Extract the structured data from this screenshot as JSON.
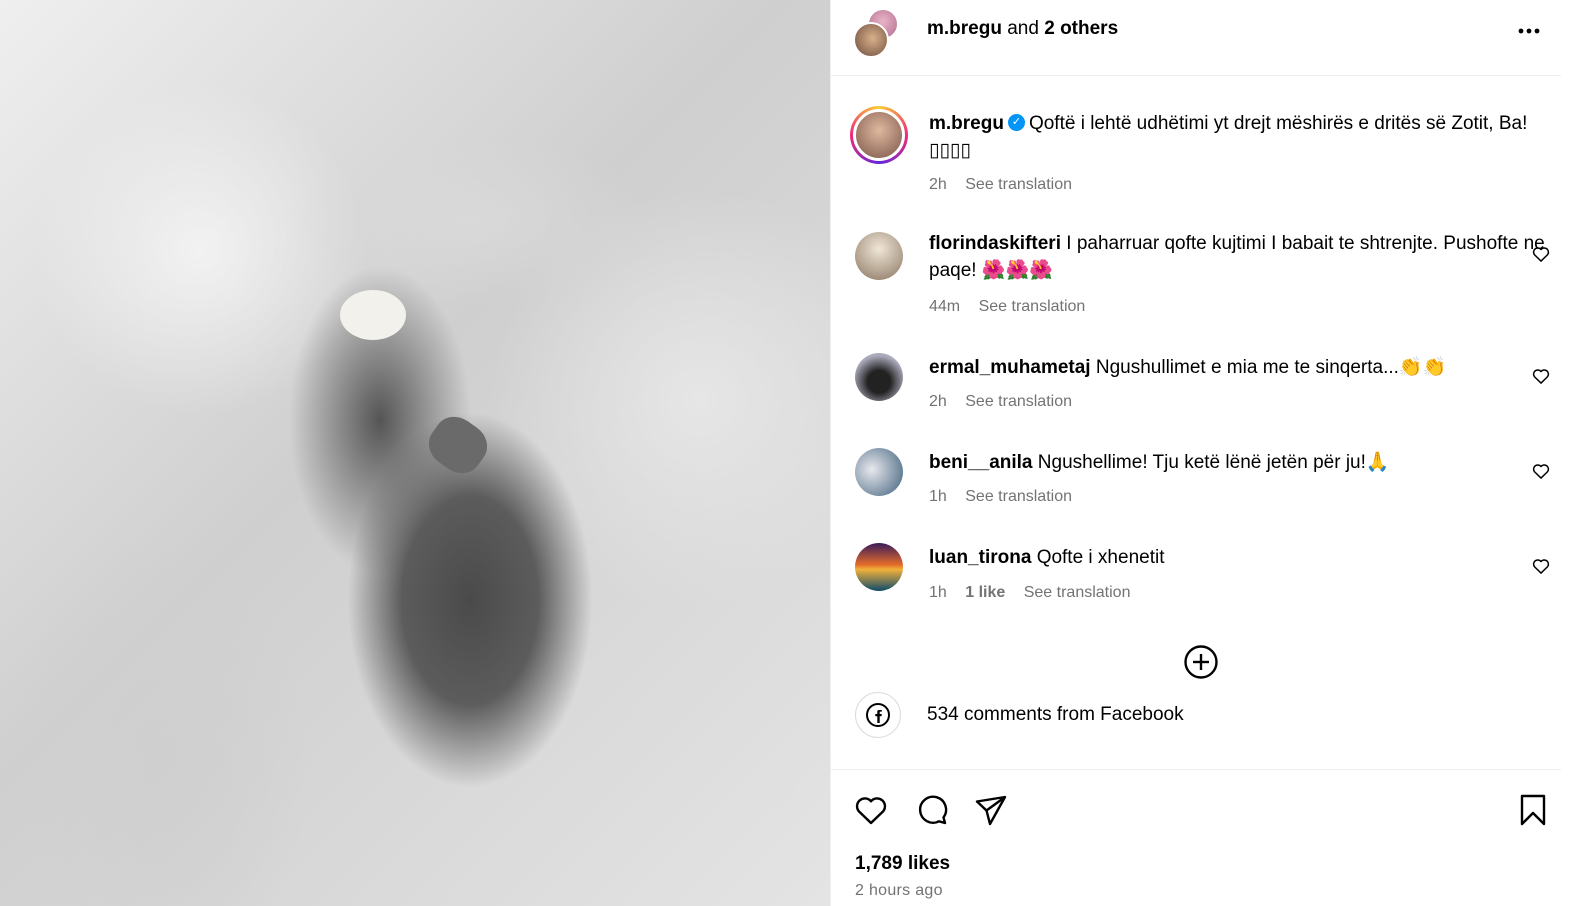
{
  "header": {
    "username": "m.bregu",
    "joiner": "and",
    "others": "2 others",
    "more_icon": "more-horizontal-icon"
  },
  "caption": {
    "username": "m.bregu",
    "verified_icon": "verified-badge-icon",
    "text": "Qoftë i lehtë udhëtimi yt drejt mëshirës e dritës së Zotit, Ba! ▯▯▯▯",
    "time": "2h",
    "translate": "See translation"
  },
  "comments": [
    {
      "username": "florindaskifteri",
      "text": "I paharruar qofte kujtimi I babait te shtrenjte. Pushofte ne paqe! 🌺🌺🌺",
      "time": "44m",
      "likes": "",
      "translate": "See translation"
    },
    {
      "username": "ermal_muhametaj",
      "text": "Ngushullimet e mia me te sinqerta...👏👏",
      "time": "2h",
      "likes": "",
      "translate": "See translation"
    },
    {
      "username": "beni__anila",
      "text": "Ngushellime! Tju ketë lënë jetën për ju!🙏",
      "time": "1h",
      "likes": "",
      "translate": "See translation"
    },
    {
      "username": "luan_tirona",
      "text": "Qofte i xhenetit",
      "time": "1h",
      "likes": "1 like",
      "translate": "See translation"
    }
  ],
  "load_more_icon": "plus-circle-icon",
  "facebook": {
    "icon": "facebook-icon",
    "text": "534 comments from Facebook"
  },
  "actions": {
    "like_icon": "heart-icon",
    "comment_icon": "comment-icon",
    "share_icon": "share-icon",
    "save_icon": "bookmark-icon"
  },
  "likes_text": "1,789 likes",
  "posted_ago": "2 hours ago",
  "photo_alt": "black and white hands"
}
